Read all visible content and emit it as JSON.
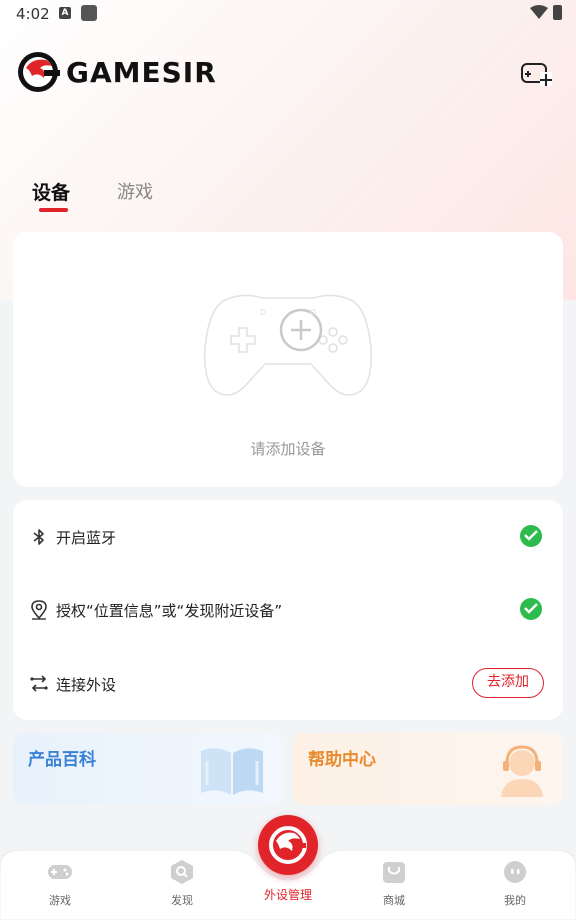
{
  "status_bar": {
    "time": "4:02",
    "notification_badge": "A"
  },
  "header": {
    "brand": "GAMESIR",
    "add_device_icon": "controller-plus-icon"
  },
  "tabs": [
    {
      "label": "设备",
      "active": true
    },
    {
      "label": "游戏",
      "active": false
    }
  ],
  "device_card": {
    "empty_label": "请添加设备",
    "icon": "controller-add-icon"
  },
  "setup": {
    "rows": [
      {
        "label": "开启蓝牙",
        "icon": "bluetooth-icon",
        "status": "done"
      },
      {
        "label": "授权“位置信息”或“发现附近设备”",
        "icon": "location-icon",
        "status": "done"
      },
      {
        "label": "连接外设",
        "icon": "connect-icon",
        "action_label": "去添加"
      }
    ]
  },
  "promos": [
    {
      "title": "产品百科",
      "icon": "book-icon"
    },
    {
      "title": "帮助中心",
      "icon": "support-agent-icon"
    }
  ],
  "bottom_nav": {
    "items": [
      {
        "label": "游戏",
        "icon": "gamepad-icon"
      },
      {
        "label": "发现",
        "icon": "discover-icon"
      },
      {
        "label": "外设管理",
        "icon": "gamesir-logo-icon",
        "active": true
      },
      {
        "label": "商城",
        "icon": "shop-bag-icon"
      },
      {
        "label": "我的",
        "icon": "profile-icon"
      }
    ]
  },
  "colors": {
    "accent": "#e0242a",
    "success": "#2dbb4d",
    "wiki": "#3a82d6",
    "help": "#e88a2e"
  }
}
